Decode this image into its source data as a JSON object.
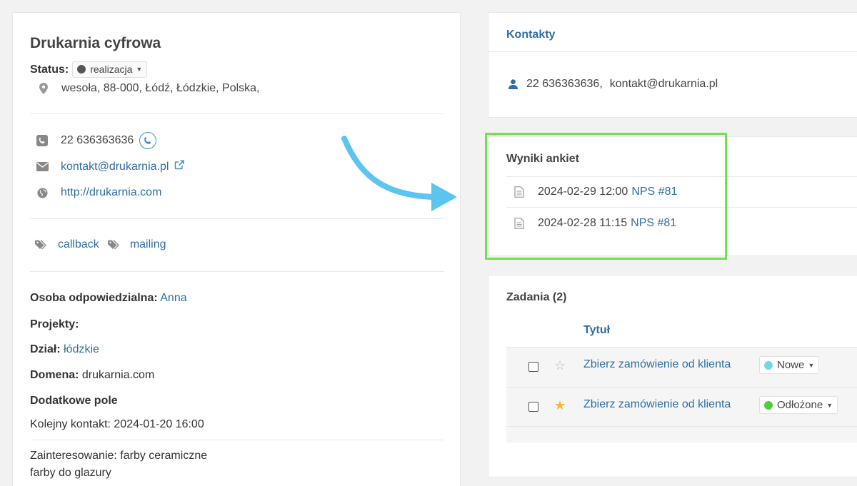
{
  "company": {
    "name": "Drukarnia cyfrowa",
    "status_label": "Status:",
    "status_value": "realizacja",
    "status_color": "#555555",
    "address": "wesoła, 88-000, Łódź, Łódzkie, Polska,"
  },
  "contact_info": {
    "phone": "22 636363636",
    "email": "kontakt@drukarnia.pl",
    "website": "http://drukarnia.com"
  },
  "tags": [
    "callback",
    "mailing"
  ],
  "details": {
    "responsible_label": "Osoba odpowiedzialna:",
    "responsible_value": "Anna",
    "projects_label": "Projekty:",
    "department_label": "Dział:",
    "department_value": "łódzkie",
    "domain_label": "Domena:",
    "domain_value": "drukarnia.com",
    "extra_field_label": "Dodatkowe pole",
    "next_contact": "Kolejny kontakt: 2024-01-20 16:00",
    "interest_line1": "Zainteresowanie: farby ceramiczne",
    "interest_line2": "farby do glazury"
  },
  "contacts_card": {
    "title": "Kontakty",
    "entry_phone": "22 636363636,",
    "entry_email": "kontakt@drukarnia.pl"
  },
  "surveys_card": {
    "title": "Wyniki ankiet",
    "items": [
      {
        "date": "2024-02-29 12:00",
        "link": "NPS #81"
      },
      {
        "date": "2024-02-28 11:15",
        "link": "NPS #81"
      }
    ]
  },
  "tasks_card": {
    "title": "Zadania (2)",
    "column_title": "Tytuł",
    "rows": [
      {
        "title": "Zbierz zamówienie od klienta",
        "starred": false,
        "status": "Nowe",
        "status_color": "#6fd8e8"
      },
      {
        "title": "Zbierz zamówienie od klienta",
        "starred": true,
        "status": "Odłożone",
        "status_color": "#4ccf3a"
      }
    ]
  },
  "colors": {
    "link": "#2f6ea5",
    "highlight": "#6fe34a",
    "arrow": "#5bc4ef",
    "star_active": "#f5b731"
  }
}
